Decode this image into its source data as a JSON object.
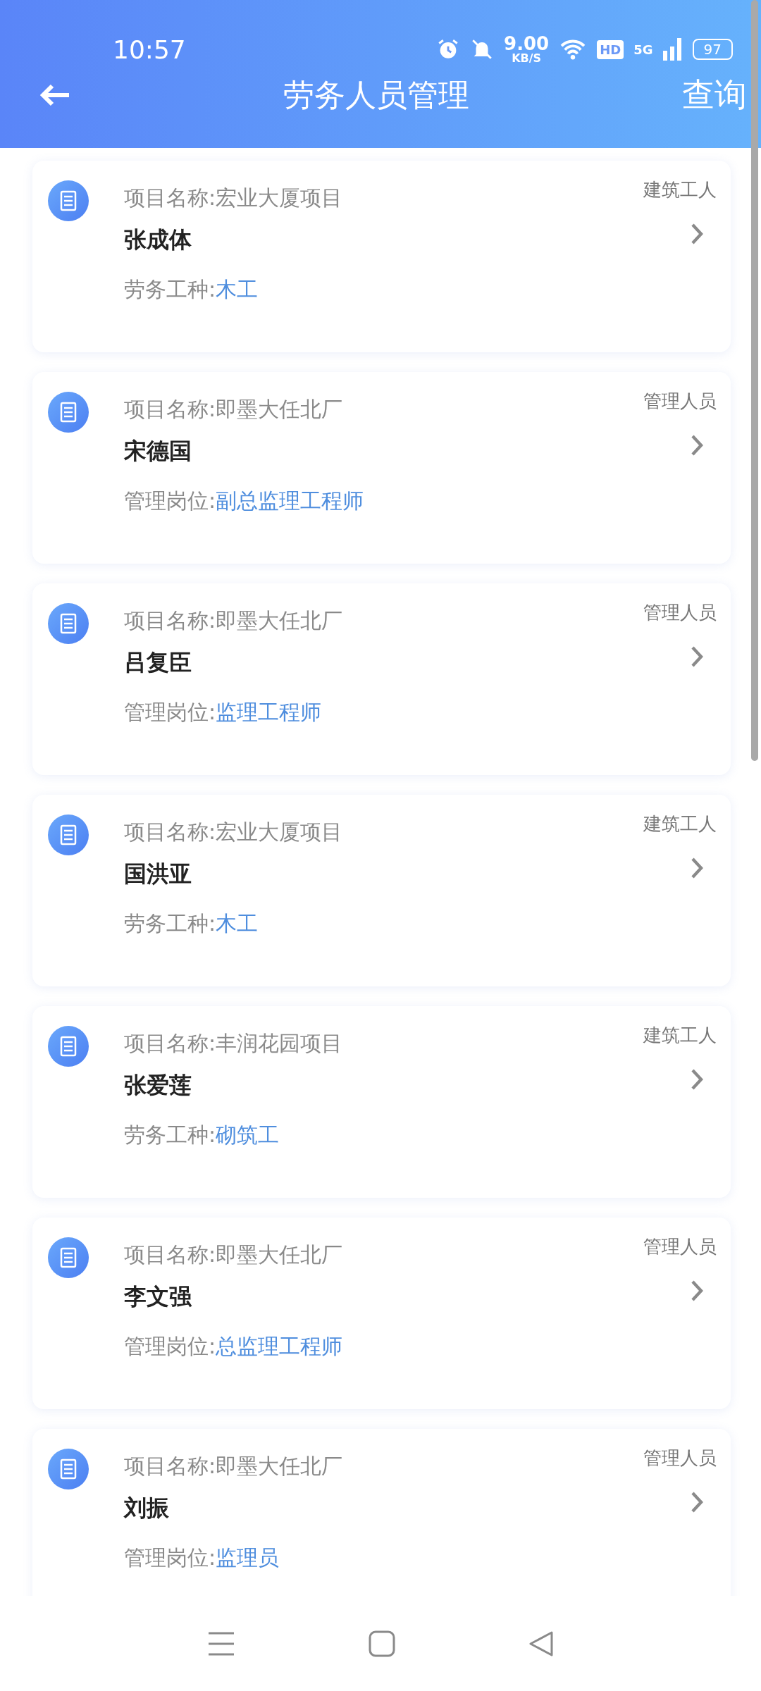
{
  "status_bar": {
    "time": "10:57",
    "net_speed": "9.00",
    "net_unit": "KB/S",
    "hd": "HD",
    "network": "5G",
    "battery": "97"
  },
  "header": {
    "title": "劳务人员管理",
    "action": "查询"
  },
  "cards": [
    {
      "project": "项目名称:宏业大厦项目",
      "category": "建筑工人",
      "name": "张成体",
      "field_label": "劳务工种:",
      "field_value": "木工"
    },
    {
      "project": "项目名称:即墨大任北厂",
      "category": "管理人员",
      "name": "宋德国",
      "field_label": "管理岗位:",
      "field_value": "副总监理工程师"
    },
    {
      "project": "项目名称:即墨大任北厂",
      "category": "管理人员",
      "name": "吕复臣",
      "field_label": "管理岗位:",
      "field_value": "监理工程师"
    },
    {
      "project": "项目名称:宏业大厦项目",
      "category": "建筑工人",
      "name": "国洪亚",
      "field_label": "劳务工种:",
      "field_value": "木工"
    },
    {
      "project": "项目名称:丰润花园项目",
      "category": "建筑工人",
      "name": "张爱莲",
      "field_label": "劳务工种:",
      "field_value": "砌筑工"
    },
    {
      "project": "项目名称:即墨大任北厂",
      "category": "管理人员",
      "name": "李文强",
      "field_label": "管理岗位:",
      "field_value": "总监理工程师"
    },
    {
      "project": "项目名称:即墨大任北厂",
      "category": "管理人员",
      "name": "刘振",
      "field_label": "管理岗位:",
      "field_value": "监理员"
    }
  ]
}
